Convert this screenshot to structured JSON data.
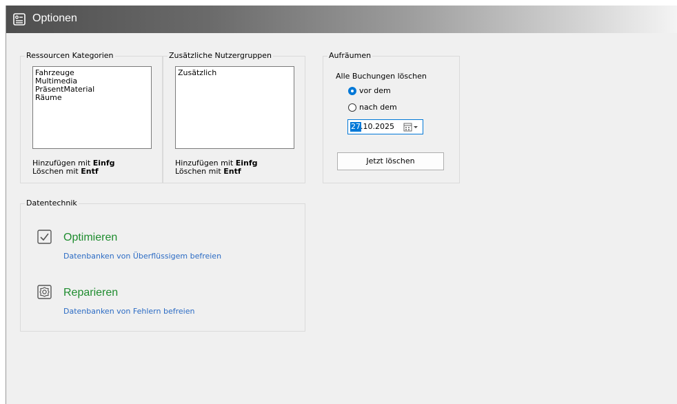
{
  "window": {
    "title": "Optionen",
    "title_icon": "options-form-icon"
  },
  "ressourcen": {
    "title": "Ressourcen Kategorien",
    "items": [
      "Fahrzeuge",
      "Multimedia",
      "PräsentMaterial",
      "Räume"
    ],
    "hint_add_prefix": "Hinzufügen mit ",
    "hint_add_key": "Einfg",
    "hint_del_prefix": "Löschen mit ",
    "hint_del_key": "Entf"
  },
  "nutzergruppen": {
    "title": "Zusätzliche Nutzergruppen",
    "items": [
      "Zusätzlich"
    ],
    "hint_add_prefix": "Hinzufügen mit ",
    "hint_add_key": "Einfg",
    "hint_del_prefix": "Löschen mit ",
    "hint_del_key": "Entf"
  },
  "aufraeumen": {
    "title": "Aufräumen",
    "label": "Alle Buchungen löschen",
    "option_before": "vor dem",
    "option_after": "nach dem",
    "selected": "vor dem",
    "date_selected_part": "27",
    "date_rest": ".10.2025",
    "button": "Jetzt löschen"
  },
  "datentechnik": {
    "title": "Datentechnik",
    "optimize": {
      "label": "Optimieren",
      "description": "Datenbanken von Überflüssigem befreien",
      "icon": "checkbox-check-icon"
    },
    "repair": {
      "label": "Reparieren",
      "description": "Datenbanken von Fehlern befreien",
      "icon": "gear-icon"
    }
  },
  "colors": {
    "accent": "#0078d7",
    "green": "#1e8c2e",
    "link": "#2b6bc4",
    "panel": "#f0f0f0"
  }
}
